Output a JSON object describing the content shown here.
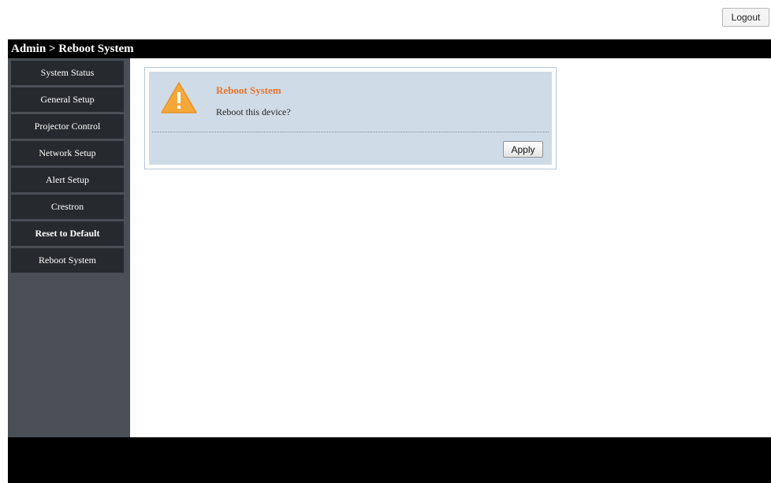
{
  "top": {
    "logout_label": "Logout"
  },
  "header": {
    "title": "Admin > Reboot System"
  },
  "sidebar": {
    "items": [
      {
        "label": "System Status"
      },
      {
        "label": "General Setup"
      },
      {
        "label": "Projector Control"
      },
      {
        "label": "Network Setup"
      },
      {
        "label": "Alert Setup"
      },
      {
        "label": "Crestron"
      },
      {
        "label": "Reset to Default"
      },
      {
        "label": "Reboot System"
      }
    ]
  },
  "panel": {
    "icon": "warning-icon",
    "title": "Reboot System",
    "message": "Reboot this device?",
    "apply_label": "Apply"
  },
  "colors": {
    "header_bg": "#000000",
    "sidebar_bg": "#4a4e55",
    "nav_item_bg": "#262a2e",
    "panel_bg": "#cfdbe6",
    "panel_title": "#e8742a",
    "warning_icon": "#f4a83a"
  }
}
